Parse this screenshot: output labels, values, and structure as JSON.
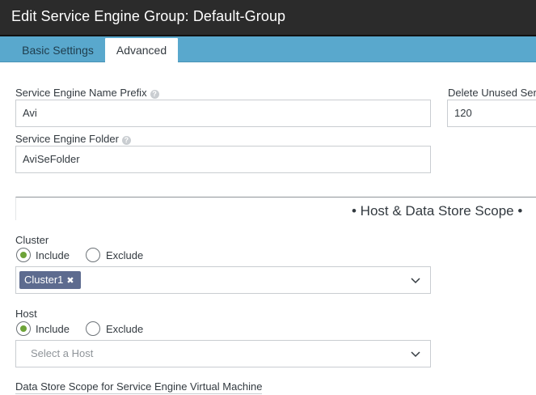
{
  "window": {
    "title": "Edit Service Engine Group: Default-Group"
  },
  "tabs": [
    {
      "label": "Basic Settings",
      "active": false
    },
    {
      "label": "Advanced",
      "active": true
    }
  ],
  "form": {
    "name_prefix": {
      "label": "Service Engine Name Prefix",
      "value": "Avi"
    },
    "folder": {
      "label": "Service Engine Folder",
      "value": "AviSeFolder"
    },
    "delete_unused": {
      "label": "Delete Unused Ser",
      "value": "120"
    }
  },
  "section": {
    "title": "• Host & Data Store Scope •"
  },
  "cluster": {
    "label": "Cluster",
    "include_label": "Include",
    "exclude_label": "Exclude",
    "selected": "Include",
    "chips": [
      "Cluster1"
    ],
    "chip_remove": "✖"
  },
  "host": {
    "label": "Host",
    "include_label": "Include",
    "exclude_label": "Exclude",
    "selected": "Include",
    "placeholder": "Select a Host"
  },
  "datastore": {
    "label": "Data Store Scope for Service Engine Virtual Machine"
  },
  "icons": {
    "help": "?",
    "chevron": "chevron-down-icon"
  },
  "colors": {
    "titlebar": "#2b2b2b",
    "tabbar": "#59a8cd",
    "chip": "#5d6b8f",
    "radio_checked": "#6da338"
  }
}
